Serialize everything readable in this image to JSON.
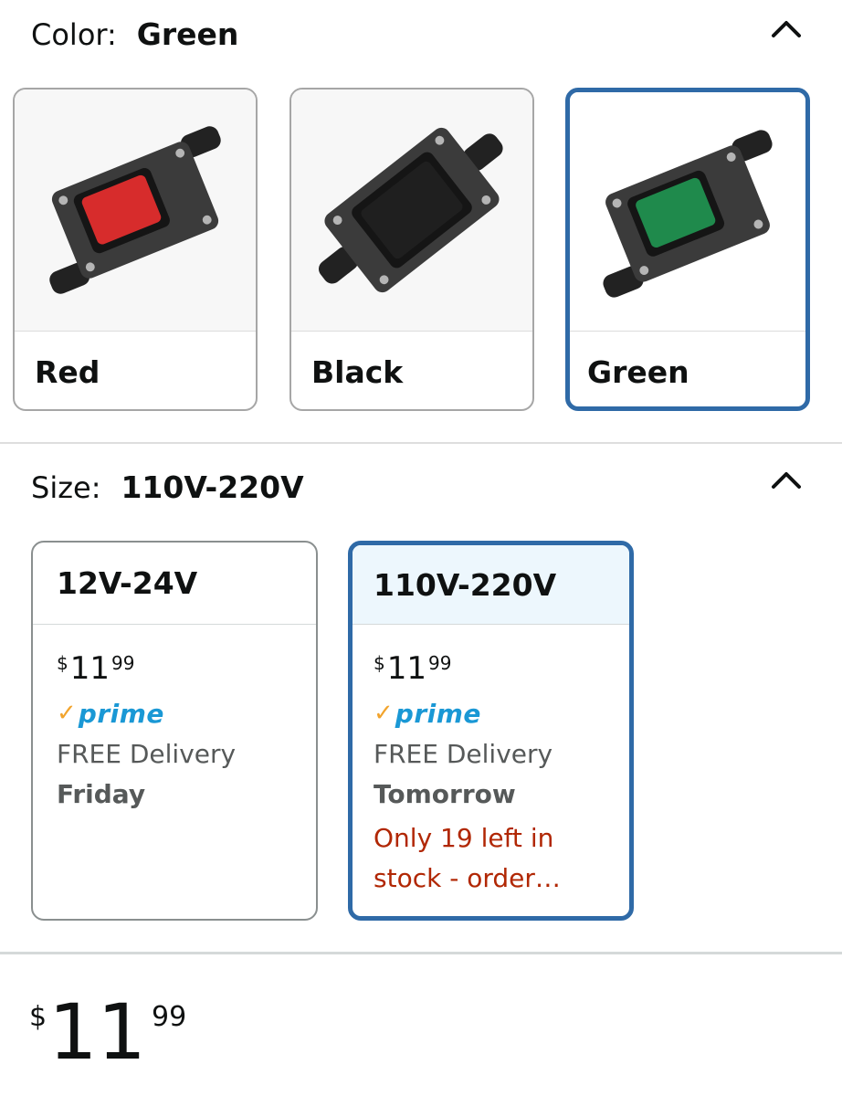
{
  "color": {
    "label": "Color:",
    "selected": "Green",
    "options": [
      {
        "label": "Red",
        "switch_color": "#d72c2c"
      },
      {
        "label": "Black",
        "switch_color": "#1f1f1f"
      },
      {
        "label": "Green",
        "switch_color": "#1f8a4c"
      }
    ]
  },
  "size": {
    "label": "Size:",
    "selected": "110V-220V",
    "options": [
      {
        "label": "12V-24V",
        "price": {
          "symbol": "$",
          "whole": "11",
          "fraction": "99"
        },
        "prime": "prime",
        "delivery": "FREE Delivery",
        "day": "Friday",
        "stock": ""
      },
      {
        "label": "110V-220V",
        "price": {
          "symbol": "$",
          "whole": "11",
          "fraction": "99"
        },
        "prime": "prime",
        "delivery": "FREE Delivery",
        "day": "Tomorrow",
        "stock": "Only 19 left in stock - order…"
      }
    ]
  },
  "price": {
    "symbol": "$",
    "whole": "11",
    "fraction": "99"
  },
  "icons": {
    "collapse": "chevron-up-icon",
    "prime_check": "prime-check-icon"
  },
  "colors": {
    "accent": "#2f6aa7",
    "prime": "#1a98d5",
    "stock": "#b12704",
    "selected_bg": "#edf7fd"
  }
}
